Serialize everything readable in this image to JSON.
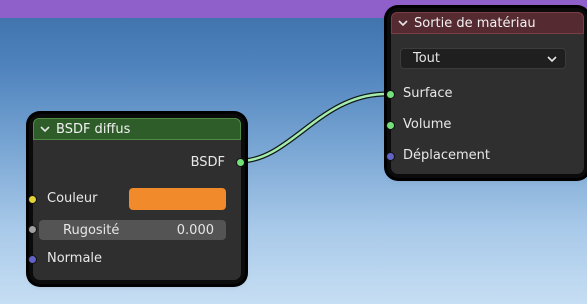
{
  "colors": {
    "background_top": "#3c6fa8",
    "background_bottom": "#c6def3",
    "top_strip": "#8f60c9",
    "shader_header": "#2e5d2a",
    "output_header": "#552a31",
    "node_body": "#2f2f2f",
    "wire": "#a6ecb0",
    "socket_shader": "#74e07a",
    "socket_color": "#e2d23a",
    "socket_float": "#a1a1a1",
    "socket_vector": "#6363c7",
    "color_value": "#f08a2a"
  },
  "bsdf_node": {
    "title": "BSDF diffus",
    "output_label": "BSDF",
    "inputs": {
      "color_label": "Couleur",
      "roughness_label": "Rugosité",
      "roughness_value": "0.000",
      "normal_label": "Normale"
    }
  },
  "output_node": {
    "title": "Sortie de matériau",
    "target_selected": "Tout",
    "inputs": {
      "surface": "Surface",
      "volume": "Volume",
      "displacement": "Déplacement"
    }
  }
}
